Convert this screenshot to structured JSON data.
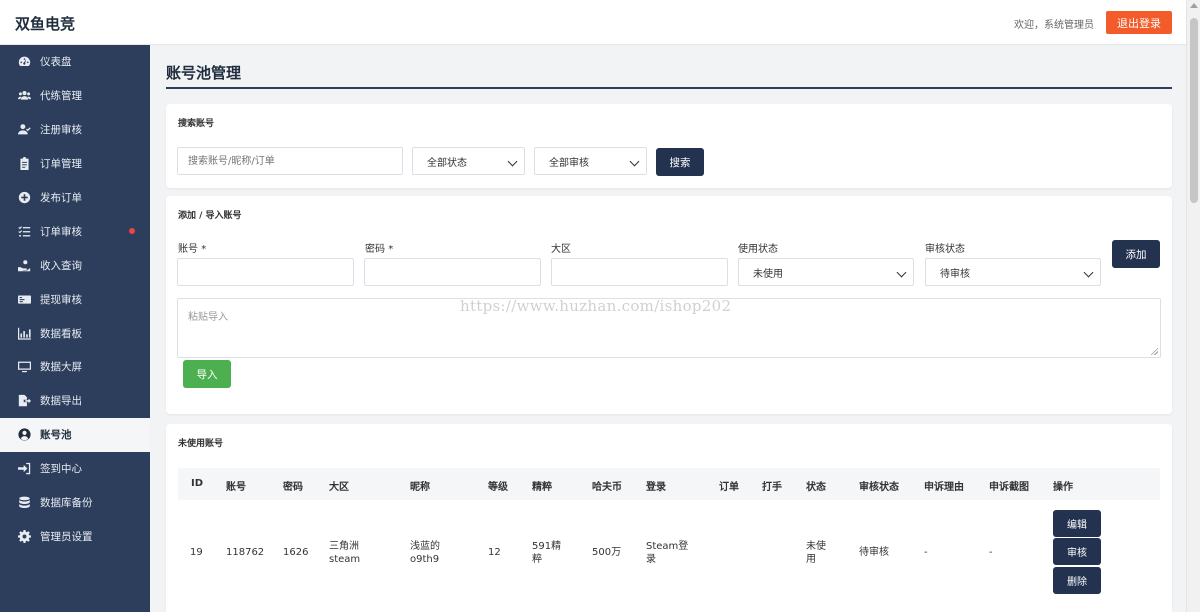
{
  "app": {
    "brand": "双鱼电竞",
    "welcome": "欢迎，系统管理员",
    "logout_label": "退出登录"
  },
  "sidebar": {
    "items": [
      {
        "label": "仪表盘",
        "icon": "dashboard-icon"
      },
      {
        "label": "代练管理",
        "icon": "users-icon"
      },
      {
        "label": "注册审核",
        "icon": "user-check-icon"
      },
      {
        "label": "订单管理",
        "icon": "clipboard-icon"
      },
      {
        "label": "发布订单",
        "icon": "plus-circle-icon"
      },
      {
        "label": "订单审核",
        "icon": "list-check-icon"
      },
      {
        "label": "收入查询",
        "icon": "hand-coin-icon"
      },
      {
        "label": "提现审核",
        "icon": "money-card-icon"
      },
      {
        "label": "数据看板",
        "icon": "chart-icon"
      },
      {
        "label": "数据大屏",
        "icon": "monitor-icon"
      },
      {
        "label": "数据导出",
        "icon": "file-export-icon"
      },
      {
        "label": "账号池",
        "icon": "user-circle-icon"
      },
      {
        "label": "签到中心",
        "icon": "sign-in-icon"
      },
      {
        "label": "数据库备份",
        "icon": "database-icon"
      },
      {
        "label": "管理员设置",
        "icon": "gear-icon"
      }
    ],
    "active_index": 11,
    "badge_index": 5
  },
  "page": {
    "title": "账号池管理"
  },
  "search": {
    "title": "搜索账号",
    "input_placeholder": "搜索账号/昵称/订单",
    "status_select": "全部状态",
    "audit_select": "全部审核",
    "button": "搜索"
  },
  "add": {
    "title": "添加 / 导入账号",
    "fields": {
      "account": "账号",
      "password": "密码",
      "region": "大区",
      "use_status": "使用状态",
      "audit_status": "审核状态"
    },
    "required_mark": "*",
    "use_status_value": "未使用",
    "audit_status_value": "待审核",
    "add_button": "添加",
    "paste_placeholder": "粘贴导入",
    "import_button": "导入"
  },
  "watermark": "https://www.huzhan.com/ishop202",
  "table": {
    "title": "未使用账号",
    "headers": [
      "ID",
      "账号",
      "密码",
      "大区",
      "昵称",
      "等级",
      "精粹",
      "哈夫币",
      "登录",
      "订单",
      "打手",
      "状态",
      "审核状态",
      "申诉理由",
      "申诉截图",
      "操作"
    ],
    "rows": [
      {
        "id": "19",
        "account": "118762",
        "password": "1626",
        "region": "三角洲 steam",
        "nickname": "浅蓝的 o9th9",
        "level": "12",
        "essence": "591精 粹",
        "coins": "500万",
        "login": "Steam登 录",
        "order": "",
        "player": "",
        "status": "未使 用",
        "audit": "待审核",
        "appeal_reason": "-",
        "appeal_screenshot": "-",
        "actions": [
          "编辑",
          "审核",
          "删除"
        ]
      }
    ]
  }
}
